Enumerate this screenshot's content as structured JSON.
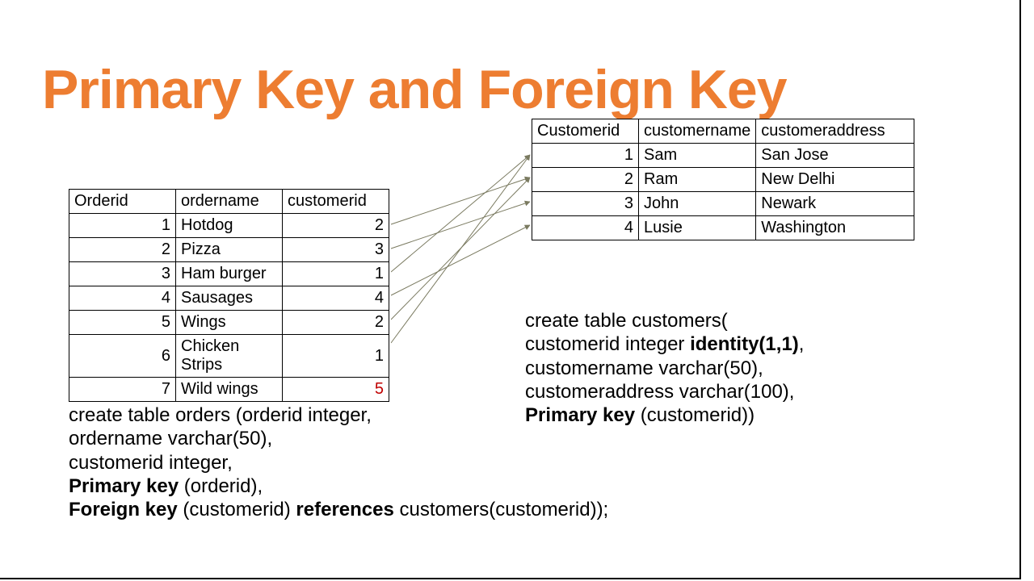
{
  "title": "Primary Key and Foreign Key",
  "orders": {
    "headers": {
      "c1": "Orderid",
      "c2": "ordername",
      "c3": "customerid"
    },
    "rows": [
      {
        "id": "1",
        "name": "Hotdog",
        "cust": "2",
        "invalid": false
      },
      {
        "id": "2",
        "name": "Pizza",
        "cust": "3",
        "invalid": false
      },
      {
        "id": "3",
        "name": "Ham burger",
        "cust": "1",
        "invalid": false
      },
      {
        "id": "4",
        "name": "Sausages",
        "cust": "4",
        "invalid": false
      },
      {
        "id": "5",
        "name": "Wings",
        "cust": "2",
        "invalid": false
      },
      {
        "id": "6",
        "name": "Chicken Strips",
        "cust": "1",
        "invalid": false
      },
      {
        "id": "7",
        "name": "Wild wings",
        "cust": "5",
        "invalid": true
      }
    ]
  },
  "customers": {
    "headers": {
      "c1": "Customerid",
      "c2": "customername",
      "c3": "customeraddress"
    },
    "rows": [
      {
        "id": "1",
        "name": "Sam",
        "addr": "San Jose"
      },
      {
        "id": "2",
        "name": "Ram",
        "addr": "New Delhi"
      },
      {
        "id": "3",
        "name": "John",
        "addr": "Newark"
      },
      {
        "id": "4",
        "name": "Lusie",
        "addr": "Washington"
      }
    ]
  },
  "code_orders": {
    "l1": "create table orders (orderid integer,",
    "l2": "ordername varchar(50),",
    "l3": "customerid integer,",
    "l4a": "Primary key",
    "l4b": " (orderid),",
    "l5a": "Foreign key",
    "l5b": " (customerid) ",
    "l5c": "references",
    "l5d": " customers(customerid));"
  },
  "code_cust": {
    "l1": "create table customers(",
    "l2a": "customerid integer ",
    "l2b": "identity(1,1)",
    "l2c": ",",
    "l3": "customername varchar(50),",
    "l4": "customeraddress varchar(100),",
    "l5a": "Primary key",
    "l5b": " (customerid))"
  }
}
